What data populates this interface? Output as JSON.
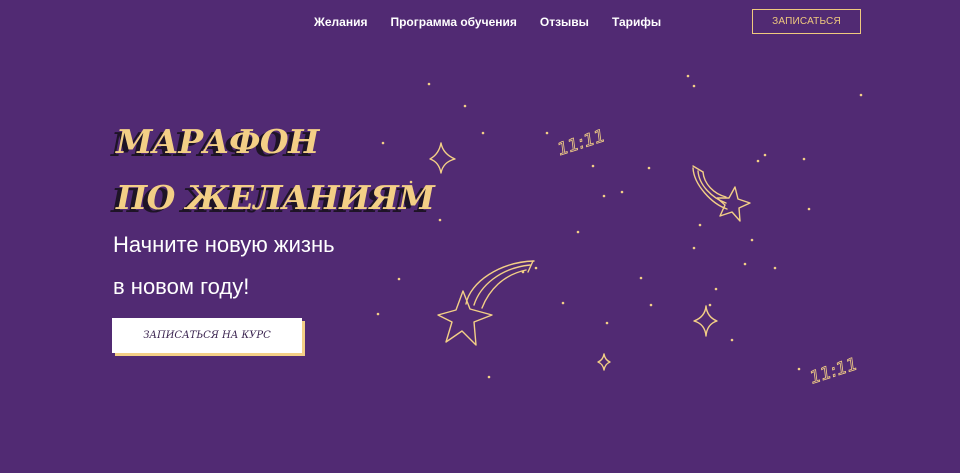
{
  "nav": {
    "items": [
      {
        "label": "Желания"
      },
      {
        "label": "Программа обучения"
      },
      {
        "label": "Отзывы"
      },
      {
        "label": "Тарифы"
      }
    ],
    "signup_label": "ЗАПИСАТЬСЯ"
  },
  "hero": {
    "title_line1": "МАРАФОН",
    "title_line2": "ПО ЖЕЛАНИЯМ",
    "subtitle_line1": "Начните новую жизнь",
    "subtitle_line2": "в новом году!",
    "cta_label": "ЗАПИСАТЬСЯ НА КУРС"
  },
  "decor": {
    "text_1111": "11:11"
  },
  "colors": {
    "background": "#512a73",
    "accent_gold": "#f3cf86",
    "text_white": "#ffffff",
    "title_shadow": "#1e1426"
  }
}
